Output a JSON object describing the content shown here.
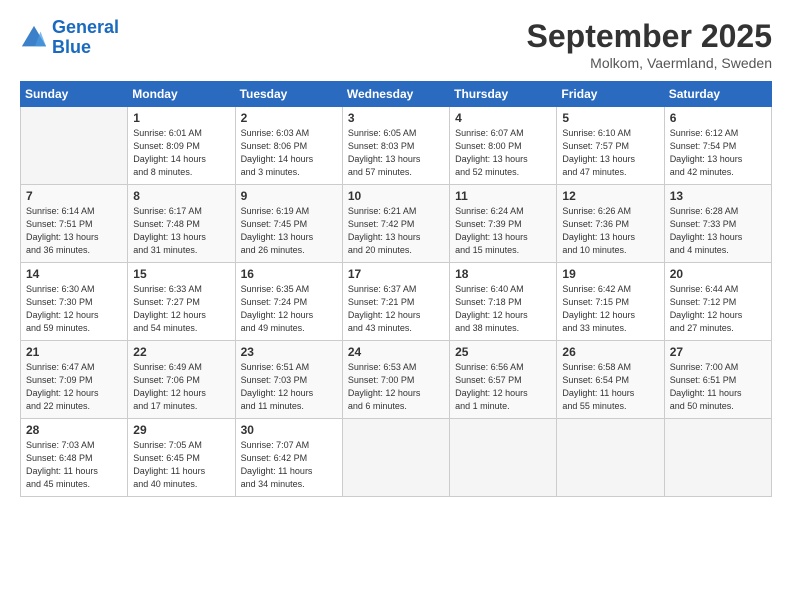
{
  "logo": {
    "line1": "General",
    "line2": "Blue"
  },
  "title": "September 2025",
  "location": "Molkom, Vaermland, Sweden",
  "headers": [
    "Sunday",
    "Monday",
    "Tuesday",
    "Wednesday",
    "Thursday",
    "Friday",
    "Saturday"
  ],
  "weeks": [
    [
      {
        "day": "",
        "info": ""
      },
      {
        "day": "1",
        "info": "Sunrise: 6:01 AM\nSunset: 8:09 PM\nDaylight: 14 hours\nand 8 minutes."
      },
      {
        "day": "2",
        "info": "Sunrise: 6:03 AM\nSunset: 8:06 PM\nDaylight: 14 hours\nand 3 minutes."
      },
      {
        "day": "3",
        "info": "Sunrise: 6:05 AM\nSunset: 8:03 PM\nDaylight: 13 hours\nand 57 minutes."
      },
      {
        "day": "4",
        "info": "Sunrise: 6:07 AM\nSunset: 8:00 PM\nDaylight: 13 hours\nand 52 minutes."
      },
      {
        "day": "5",
        "info": "Sunrise: 6:10 AM\nSunset: 7:57 PM\nDaylight: 13 hours\nand 47 minutes."
      },
      {
        "day": "6",
        "info": "Sunrise: 6:12 AM\nSunset: 7:54 PM\nDaylight: 13 hours\nand 42 minutes."
      }
    ],
    [
      {
        "day": "7",
        "info": "Sunrise: 6:14 AM\nSunset: 7:51 PM\nDaylight: 13 hours\nand 36 minutes."
      },
      {
        "day": "8",
        "info": "Sunrise: 6:17 AM\nSunset: 7:48 PM\nDaylight: 13 hours\nand 31 minutes."
      },
      {
        "day": "9",
        "info": "Sunrise: 6:19 AM\nSunset: 7:45 PM\nDaylight: 13 hours\nand 26 minutes."
      },
      {
        "day": "10",
        "info": "Sunrise: 6:21 AM\nSunset: 7:42 PM\nDaylight: 13 hours\nand 20 minutes."
      },
      {
        "day": "11",
        "info": "Sunrise: 6:24 AM\nSunset: 7:39 PM\nDaylight: 13 hours\nand 15 minutes."
      },
      {
        "day": "12",
        "info": "Sunrise: 6:26 AM\nSunset: 7:36 PM\nDaylight: 13 hours\nand 10 minutes."
      },
      {
        "day": "13",
        "info": "Sunrise: 6:28 AM\nSunset: 7:33 PM\nDaylight: 13 hours\nand 4 minutes."
      }
    ],
    [
      {
        "day": "14",
        "info": "Sunrise: 6:30 AM\nSunset: 7:30 PM\nDaylight: 12 hours\nand 59 minutes."
      },
      {
        "day": "15",
        "info": "Sunrise: 6:33 AM\nSunset: 7:27 PM\nDaylight: 12 hours\nand 54 minutes."
      },
      {
        "day": "16",
        "info": "Sunrise: 6:35 AM\nSunset: 7:24 PM\nDaylight: 12 hours\nand 49 minutes."
      },
      {
        "day": "17",
        "info": "Sunrise: 6:37 AM\nSunset: 7:21 PM\nDaylight: 12 hours\nand 43 minutes."
      },
      {
        "day": "18",
        "info": "Sunrise: 6:40 AM\nSunset: 7:18 PM\nDaylight: 12 hours\nand 38 minutes."
      },
      {
        "day": "19",
        "info": "Sunrise: 6:42 AM\nSunset: 7:15 PM\nDaylight: 12 hours\nand 33 minutes."
      },
      {
        "day": "20",
        "info": "Sunrise: 6:44 AM\nSunset: 7:12 PM\nDaylight: 12 hours\nand 27 minutes."
      }
    ],
    [
      {
        "day": "21",
        "info": "Sunrise: 6:47 AM\nSunset: 7:09 PM\nDaylight: 12 hours\nand 22 minutes."
      },
      {
        "day": "22",
        "info": "Sunrise: 6:49 AM\nSunset: 7:06 PM\nDaylight: 12 hours\nand 17 minutes."
      },
      {
        "day": "23",
        "info": "Sunrise: 6:51 AM\nSunset: 7:03 PM\nDaylight: 12 hours\nand 11 minutes."
      },
      {
        "day": "24",
        "info": "Sunrise: 6:53 AM\nSunset: 7:00 PM\nDaylight: 12 hours\nand 6 minutes."
      },
      {
        "day": "25",
        "info": "Sunrise: 6:56 AM\nSunset: 6:57 PM\nDaylight: 12 hours\nand 1 minute."
      },
      {
        "day": "26",
        "info": "Sunrise: 6:58 AM\nSunset: 6:54 PM\nDaylight: 11 hours\nand 55 minutes."
      },
      {
        "day": "27",
        "info": "Sunrise: 7:00 AM\nSunset: 6:51 PM\nDaylight: 11 hours\nand 50 minutes."
      }
    ],
    [
      {
        "day": "28",
        "info": "Sunrise: 7:03 AM\nSunset: 6:48 PM\nDaylight: 11 hours\nand 45 minutes."
      },
      {
        "day": "29",
        "info": "Sunrise: 7:05 AM\nSunset: 6:45 PM\nDaylight: 11 hours\nand 40 minutes."
      },
      {
        "day": "30",
        "info": "Sunrise: 7:07 AM\nSunset: 6:42 PM\nDaylight: 11 hours\nand 34 minutes."
      },
      {
        "day": "",
        "info": ""
      },
      {
        "day": "",
        "info": ""
      },
      {
        "day": "",
        "info": ""
      },
      {
        "day": "",
        "info": ""
      }
    ]
  ]
}
